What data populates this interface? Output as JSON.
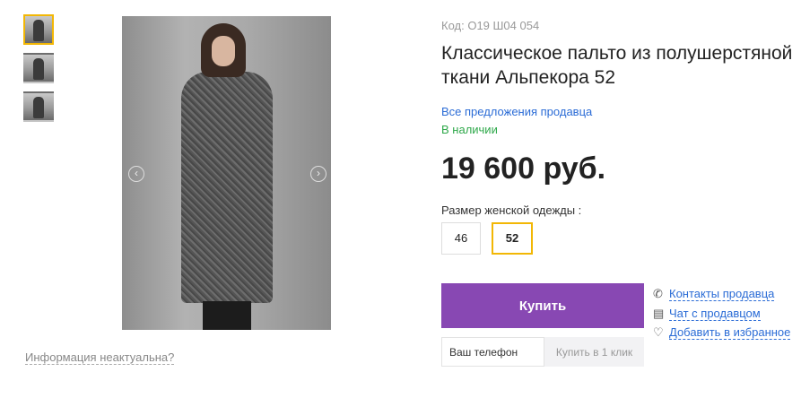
{
  "product": {
    "code": "Код: О19 Ш04 054",
    "title": "Классическое пальто из полушерстяной ткани Альпекора 52",
    "seller_offers": "Все предложения продавца",
    "availability": "В наличии",
    "price": "19 600 руб.",
    "size_label": "Размер женской одежды :",
    "sizes": [
      "46",
      "52"
    ],
    "selected_size": "52"
  },
  "actions": {
    "buy": "Купить",
    "phone_placeholder": "Ваш телефон",
    "one_click": "Купить в 1 клик"
  },
  "seller_links": {
    "contacts": "Контакты продавца",
    "chat": "Чат с продавцом",
    "favorite": "Добавить в избранное"
  },
  "gallery": {
    "outdated_notice": "Информация неактуальна?",
    "thumb_count": 3
  },
  "colors": {
    "buy_button": "#8848b3",
    "accent": "#f2b705",
    "link": "#2b6cd6",
    "in_stock": "#2ea84a"
  }
}
